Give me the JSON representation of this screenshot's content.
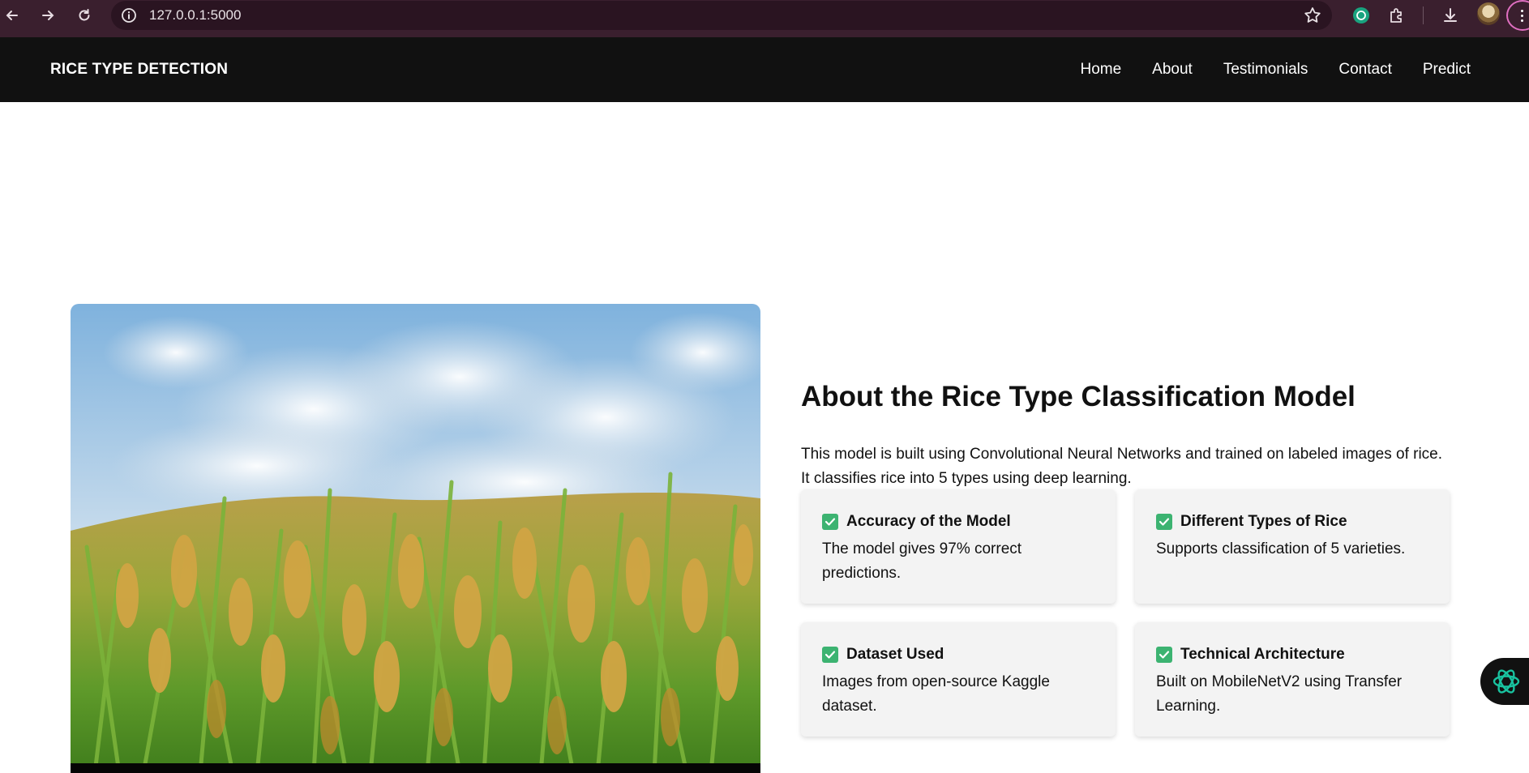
{
  "browser": {
    "url": "127.0.0.1:5000"
  },
  "site": {
    "brand": "RICE TYPE DETECTION",
    "nav": [
      {
        "label": "Home"
      },
      {
        "label": "About"
      },
      {
        "label": "Testimonials"
      },
      {
        "label": "Contact"
      },
      {
        "label": "Predict"
      }
    ]
  },
  "about": {
    "title": "About the Rice Type Classification Model",
    "description": "This model is built using Convolutional Neural Networks and trained on labeled images of rice. It classifies rice into 5 types using deep learning.",
    "cards": [
      {
        "title": "Accuracy of the Model",
        "body": "The model gives 97% correct predictions."
      },
      {
        "title": "Different Types of Rice",
        "body": "Supports classification of 5 varieties."
      },
      {
        "title": "Dataset Used",
        "body": "Images from open-source Kaggle dataset."
      },
      {
        "title": "Technical Architecture",
        "body": "Built on MobileNetV2 using Transfer Learning."
      }
    ]
  },
  "colors": {
    "browser_frame": "#3a1f2e",
    "navbar_bg": "#111111",
    "card_bg": "#f3f3f3",
    "check_green": "#3cb371"
  },
  "icons": {
    "back": "arrow-left-icon",
    "forward": "arrow-right-icon",
    "reload": "reload-icon",
    "site_info": "info-icon",
    "bookmark": "star-icon",
    "extension_chatgpt": "chatgpt-icon",
    "extensions": "puzzle-icon",
    "download": "download-icon",
    "check": "check-box-icon",
    "assistant": "chatgpt-logo-icon"
  }
}
